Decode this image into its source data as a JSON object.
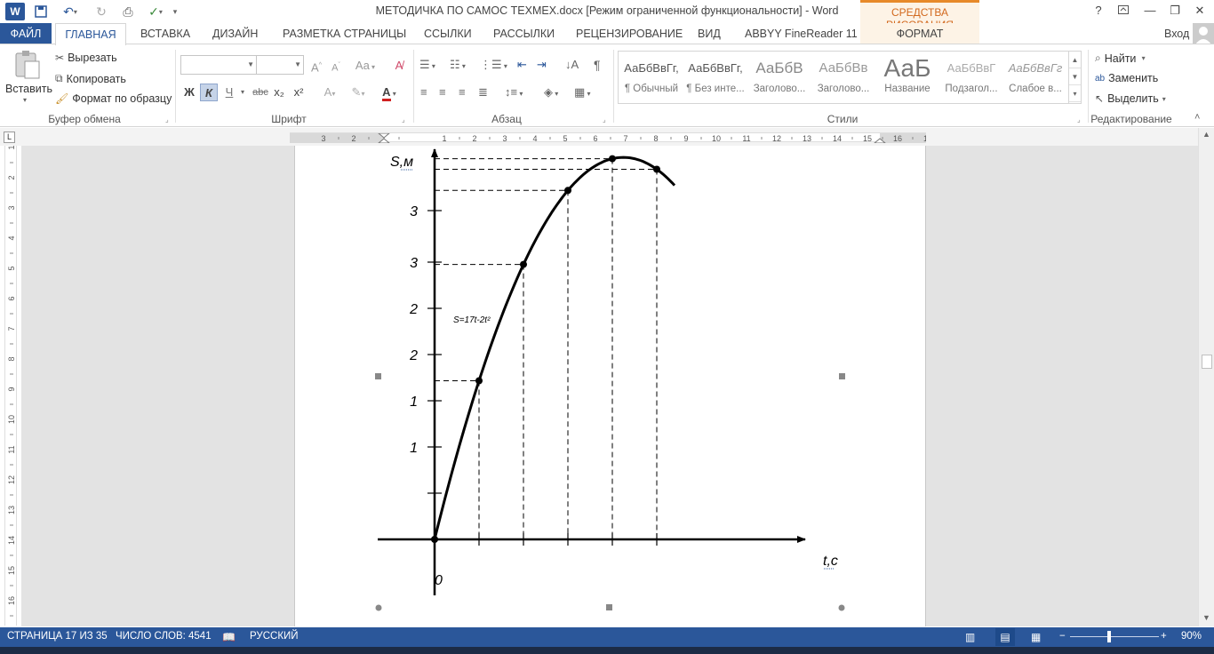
{
  "titlebar": {
    "title": "МЕТОДИЧКА ПО САМОС ТЕХМЕХ.docx [Режим ограниченной функциональности] - Word",
    "contextual_group": "СРЕДСТВА РИСОВАНИЯ",
    "help": "?",
    "minimize": "—",
    "restore": "❐",
    "close": "✕"
  },
  "tabs": {
    "file": "ФАЙЛ",
    "home": "ГЛАВНАЯ",
    "insert": "ВСТАВКА",
    "design": "ДИЗАЙН",
    "layout": "РАЗМЕТКА СТРАНИЦЫ",
    "references": "ССЫЛКИ",
    "mailings": "РАССЫЛКИ",
    "review": "РЕЦЕНЗИРОВАНИЕ",
    "view": "ВИД",
    "abbyy": "ABBYY FineReader 11",
    "format": "ФОРМАТ",
    "signin": "Вход"
  },
  "clipboard": {
    "paste": "Вставить",
    "cut": "Вырезать",
    "copy": "Копировать",
    "format_painter": "Формат по образцу",
    "label": "Буфер обмена"
  },
  "font": {
    "family_value": "",
    "size_value": "",
    "bold": "Ж",
    "italic": "К",
    "underline": "Ч",
    "strike": "abc",
    "subscript": "x₂",
    "superscript": "x²",
    "grow": "A˄",
    "shrink": "A˅",
    "case": "Aa",
    "label": "Шрифт"
  },
  "paragraph": {
    "pilcrow": "¶",
    "label": "Абзац"
  },
  "styles": {
    "items": [
      {
        "sample": "АаБбВвГг,",
        "name": "¶ Обычный"
      },
      {
        "sample": "АаБбВвГг,",
        "name": "¶ Без инте..."
      },
      {
        "sample": "АаБбВ",
        "name": "Заголово..."
      },
      {
        "sample": "АаБбВв",
        "name": "Заголово..."
      },
      {
        "sample": "АаБ",
        "name": "Название"
      },
      {
        "sample": "АаБбВвГ",
        "name": "Подзагол..."
      },
      {
        "sample": "АаБбВвГг",
        "name": "Слабое в..."
      }
    ],
    "label": "Стили"
  },
  "editing": {
    "find": "Найти",
    "replace": "Заменить",
    "select": "Выделить",
    "label": "Редактирование"
  },
  "ruler": {
    "h_ticks": [
      "3",
      "2",
      "1",
      "1",
      "2",
      "3",
      "4",
      "5",
      "6",
      "7",
      "8",
      "9",
      "10",
      "11",
      "12",
      "13",
      "14",
      "15",
      "16",
      "17"
    ],
    "v_ticks": [
      "1",
      "2",
      "3",
      "4",
      "5",
      "6",
      "7",
      "8",
      "9",
      "10",
      "11",
      "12",
      "13",
      "14",
      "15",
      "16"
    ],
    "corner": "L"
  },
  "chart_data": {
    "type": "line",
    "y_axis_label": "S,м",
    "x_axis_label": "t,c",
    "origin_label": "0",
    "formula": "S=17t-2t²",
    "y_tick_labels": [
      "1",
      "1",
      "2",
      "2",
      "3",
      "3"
    ],
    "points": [
      {
        "t": 0,
        "s": 0
      },
      {
        "t": 1,
        "s": 15
      },
      {
        "t": 2,
        "s": 26
      },
      {
        "t": 3,
        "s": 33
      },
      {
        "t": 4,
        "s": 36
      },
      {
        "t": 5,
        "s": 35
      }
    ],
    "curve_t_max": 5.4
  },
  "status": {
    "page": "СТРАНИЦА 17 ИЗ 35",
    "words": "ЧИСЛО СЛОВ: 4541",
    "language": "РУССКИЙ",
    "zoom": "90%"
  }
}
